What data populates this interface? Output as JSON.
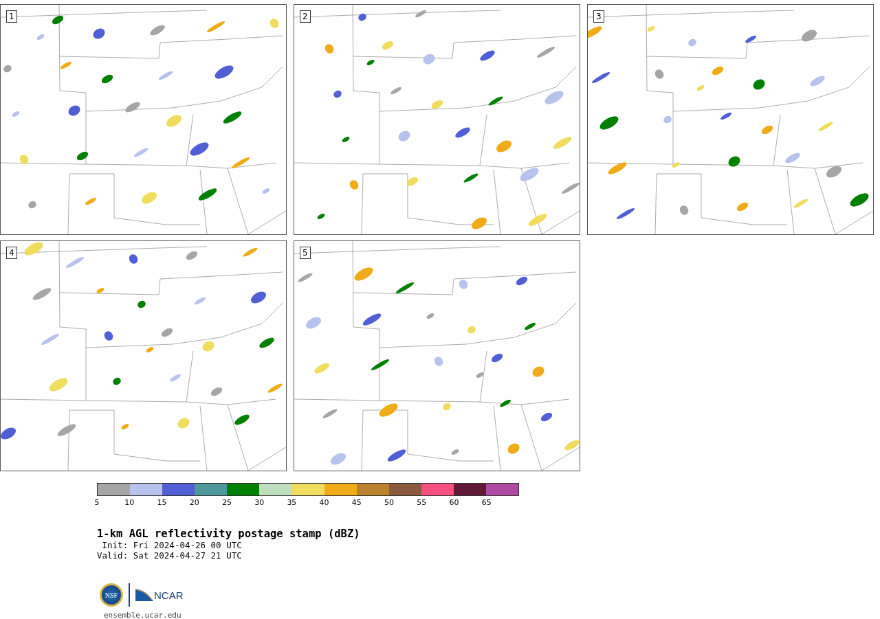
{
  "panels": [
    {
      "label": "1"
    },
    {
      "label": "2"
    },
    {
      "label": "3"
    },
    {
      "label": "4"
    },
    {
      "label": "5"
    }
  ],
  "legend": {
    "bins": [
      {
        "color": "#a6a6a6"
      },
      {
        "color": "#b7c3ed"
      },
      {
        "color": "#515fd6"
      },
      {
        "color": "#4f989c"
      },
      {
        "color": "#008000"
      },
      {
        "color": "#bfdfbf"
      },
      {
        "color": "#f0dc5f"
      },
      {
        "color": "#f0ac18"
      },
      {
        "color": "#bb8330"
      },
      {
        "color": "#8b5a3f"
      },
      {
        "color": "#f55080"
      },
      {
        "color": "#621838"
      },
      {
        "color": "#ae4aa2"
      }
    ],
    "ticks": [
      "5",
      "10",
      "15",
      "20",
      "25",
      "30",
      "35",
      "40",
      "45",
      "50",
      "55",
      "60",
      "65"
    ]
  },
  "title": "1-km AGL reflectivity postage stamp (dBZ)",
  "init": " Init: Fri 2024-04-26 00 UTC",
  "valid": "Valid: Sat 2024-04-27 21 UTC",
  "logos": {
    "nsf": "NSF",
    "ncar": "NCAR"
  },
  "url": "ensemble.ucar.edu"
}
